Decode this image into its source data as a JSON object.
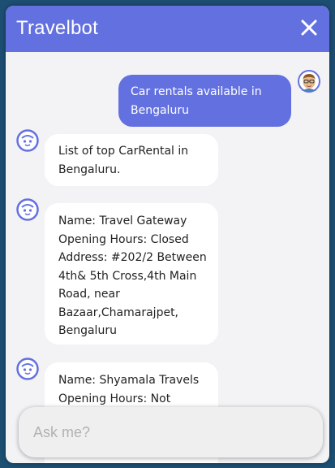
{
  "header": {
    "title": "Travelbot"
  },
  "icons": {
    "close": "close-icon",
    "bot_avatar": "bot-avatar-icon",
    "user_avatar": "user-avatar-icon"
  },
  "colors": {
    "accent": "#6371e0",
    "background": "#1d4f73",
    "panel": "#f3f3f6"
  },
  "messages": [
    {
      "sender": "user",
      "text": "Car rentals available in\nBengaluru"
    },
    {
      "sender": "bot",
      "text": "List of top CarRental in\nBengaluru."
    },
    {
      "sender": "bot",
      "text": "Name: Travel Gateway\nOpening Hours: Closed\nAddress: #202/2 Between\n4th& 5th Cross,4th Main\nRoad, near\nBazaar,Chamarajpet,\nBengaluru"
    },
    {
      "sender": "bot",
      "text": "Name: Shyamala Travels\nOpening Hours: Not"
    }
  ],
  "input": {
    "placeholder": "Ask me?",
    "value": ""
  }
}
